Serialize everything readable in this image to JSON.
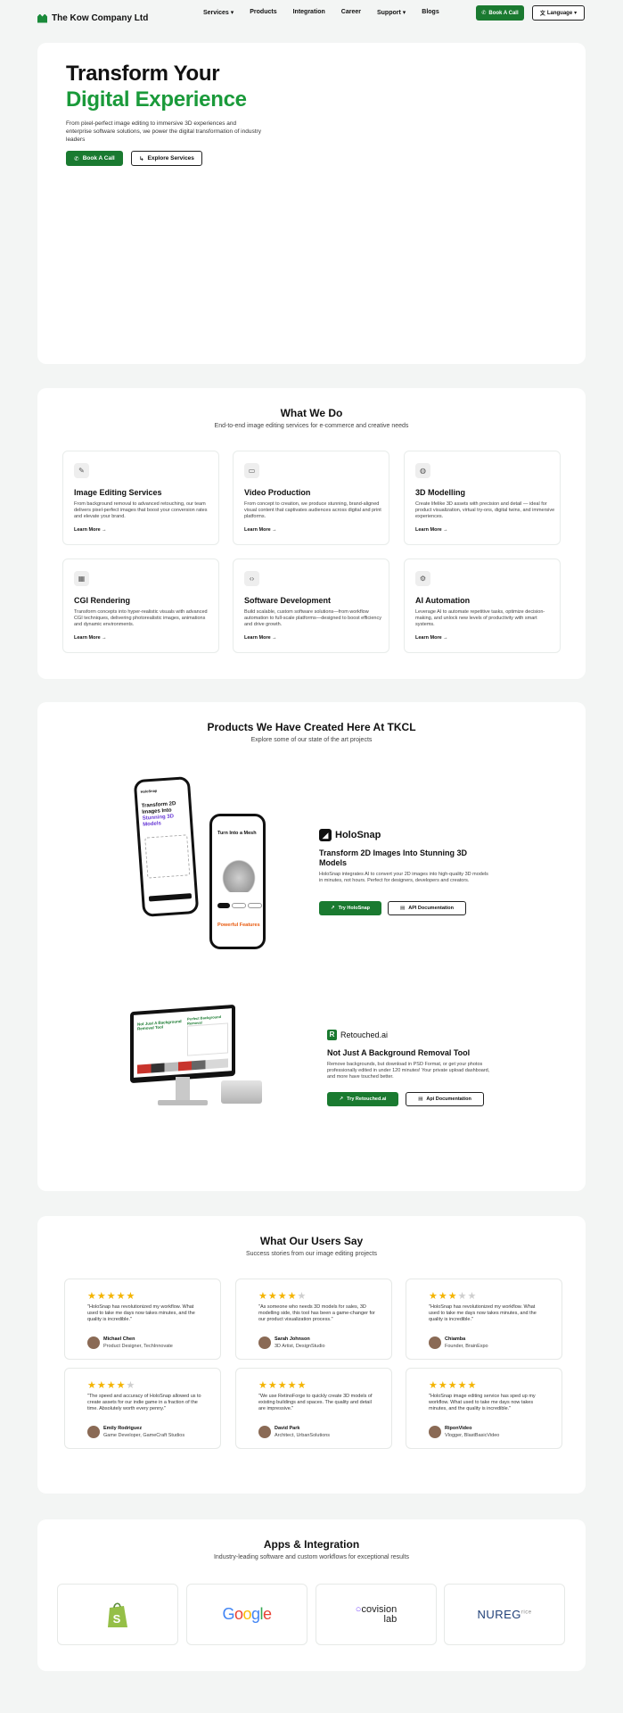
{
  "nav": {
    "brand": "The Kow Company Ltd",
    "items": [
      "Services ▾",
      "Products",
      "Integration",
      "Career",
      "Support ▾",
      "Blogs"
    ],
    "book_call": "Book A Call",
    "language": "Language"
  },
  "hero": {
    "title_line1": "Transform Your",
    "title_line2": "Digital Experience",
    "subtitle": "From pixel-perfect image editing to immersive 3D experiences and enterprise software solutions, we power the digital transformation of industry leaders",
    "cta_primary": "Book A Call",
    "cta_secondary": "Explore Services"
  },
  "services": {
    "title": "What We Do",
    "subtitle": "End-to-end image editing services for e-commerce and creative needs",
    "learn_more": "Learn More →",
    "items": [
      {
        "title": "Image Editing Services",
        "desc": "From background removal to advanced retouching, our team delivers pixel-perfect images that boost your conversion rates and elevate your brand.",
        "icon": "image-edit-icon"
      },
      {
        "title": "Video Production",
        "desc": "From concept to creation, we produce stunning, brand-aligned visual content that captivates audiences across digital and print platforms.",
        "icon": "video-icon"
      },
      {
        "title": "3D Modelling",
        "desc": "Create lifelike 3D assets with precision and detail — ideal for product visualization, virtual try-ons, digital twins, and immersive experiences.",
        "icon": "cube-icon"
      },
      {
        "title": "CGI Rendering",
        "desc": "Transform concepts into hyper-realistic visuals with advanced CGI techniques, delivering photorealistic images, animations and dynamic environments.",
        "icon": "grid-icon"
      },
      {
        "title": "Software Development",
        "desc": "Build scalable, custom software solutions—from workflow automation to full-scale platforms—designed to boost efficiency and drive growth.",
        "icon": "code-icon"
      },
      {
        "title": "AI Automation",
        "desc": "Leverage AI to automate repetitive tasks, optimize decision-making, and unlock new levels of productivity with smart systems.",
        "icon": "ai-icon"
      }
    ]
  },
  "products": {
    "title": "Products We Have Created Here At TKCL",
    "subtitle": "Explore some of our state of the art projects",
    "holosnap": {
      "name": "HoloSnap",
      "title": "Transform 2D Images Into Stunning 3D Models",
      "desc": "HoloSnap integrates AI to convert your 2D images into high-quality 3D models in minutes, not hours. Perfect for designers, developers and creators.",
      "cta_primary": "Try HoloSnap",
      "cta_secondary": "API Documentation",
      "phone1_title_a": "Transform 2D",
      "phone1_title_b": "Images Into",
      "phone1_title_c": "Stunning 3D Models",
      "phone2_title": "Turn Into a Mesh",
      "phone2_footer": "Powerful Features"
    },
    "retouched": {
      "name": "Retouched.ai",
      "title": "Not Just A Background Removal Tool",
      "desc": "Remove backgrounds, but download in PSD Format, or get your photos professionally edited in under 120 minutes! Your private upload dashboard, and more have touched better.",
      "cta_primary": "Try Retouched.ai",
      "cta_secondary": "Api Documentation",
      "screen_title": "Not Just A Background Removal Tool",
      "screen_title2": "Perfect Background Removal"
    }
  },
  "reviews": {
    "title": "What Our Users Say",
    "subtitle": "Success stories from our image editing projects",
    "items": [
      {
        "stars": 5,
        "quote": "\"HoloSnap has revolutionized my workflow. What used to take me days now takes minutes, and the quality is incredible.\"",
        "name": "Michael Chen",
        "role": "Product Designer, TechInnovate"
      },
      {
        "stars": 4,
        "quote": "\"As someone who needs 3D models for sales, 3D modelling side, this tool has been a game-changer for our product visualization process.\"",
        "name": "Sarah Johnson",
        "role": "3D Artist, DesignStudio"
      },
      {
        "stars": 3,
        "quote": "\"HoloSnap has revolutionized my workflow. What used to take me days now takes minutes, and the quality is incredible.\"",
        "name": "Chiamba",
        "role": "Founder, BrainExpo"
      },
      {
        "stars": 4,
        "quote": "\"The speed and accuracy of HoloSnap allowed us to create assets for our indie game in a fraction of the time. Absolutely worth every penny.\"",
        "name": "Emily Rodriguez",
        "role": "Game Developer, GameCraft Studios"
      },
      {
        "stars": 5,
        "quote": "\"We use RetinoForge to quickly create 3D models of existing buildings and spaces. The quality and detail are impressive.\"",
        "name": "David Park",
        "role": "Architect, UrbanSolutions"
      },
      {
        "stars": 5,
        "quote": "\"HoloSnap image editing service has sped up my workflow. What used to take me days now takes minutes, and the quality is incredible.\"",
        "name": "RiponVideo",
        "role": "Vlogger, BlastBasicVideo"
      }
    ]
  },
  "apps": {
    "title": "Apps & Integration",
    "subtitle": "Industry-leading software and custom workflows for exceptional results",
    "partners": [
      "Shopify",
      "Google",
      "covision lab",
      "NUREG"
    ],
    "partner_google_letters": [
      "G",
      "o",
      "o",
      "g",
      "l",
      "e"
    ],
    "covision_word1": "covision",
    "covision_word2": "lab",
    "nureg_word": "NUREG",
    "nureg_suffix": "rice"
  },
  "colors": {
    "brand_green": "#1a7a30",
    "accent_green": "#1a9a3a",
    "star": "#f4b400"
  }
}
